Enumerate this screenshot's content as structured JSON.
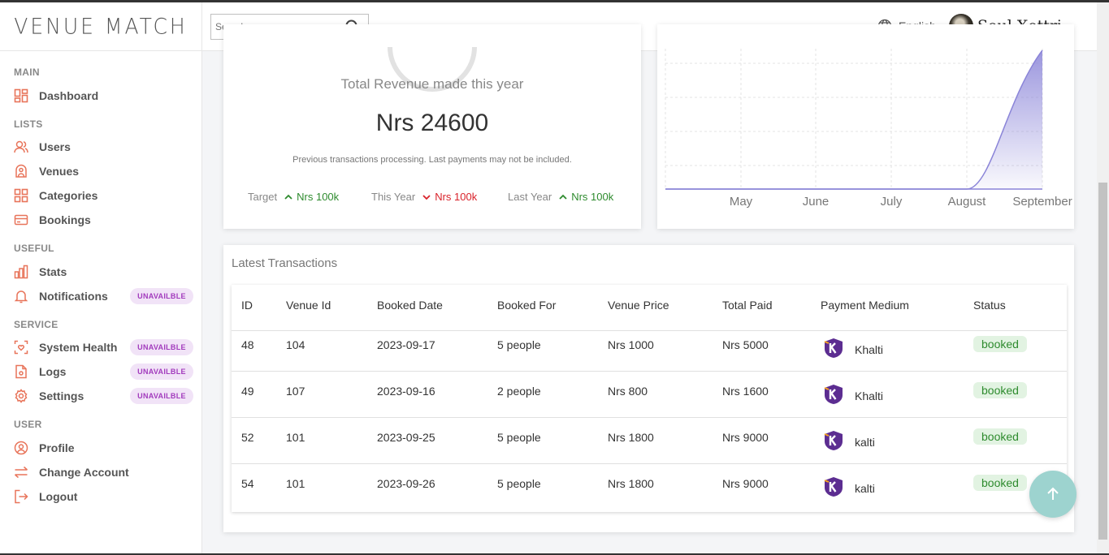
{
  "app": {
    "logo": "VENUE MATCH"
  },
  "header": {
    "search_placeholder": "Search...",
    "language": "English",
    "user_name": "Soul Xettri"
  },
  "sidebar": {
    "sections": {
      "main": "MAIN",
      "lists": "LISTS",
      "useful": "USEFUL",
      "service": "SERVICE",
      "user": "USER"
    },
    "items": {
      "dashboard": "Dashboard",
      "users": "Users",
      "venues": "Venues",
      "categories": "Categories",
      "bookings": "Bookings",
      "stats": "Stats",
      "notifications": "Notifications",
      "system_health": "System Health",
      "logs": "Logs",
      "settings": "Settings",
      "profile": "Profile",
      "change_account": "Change Account",
      "logout": "Logout"
    },
    "badge_unavailable": "UNAVAILBLE"
  },
  "revenue": {
    "title": "Total Revenue made this year",
    "amount": "Nrs 24600",
    "note": "Previous transactions processing. Last payments may not be included.",
    "stats": [
      {
        "key": "Target",
        "value": "Nrs 100k",
        "trend": "up"
      },
      {
        "key": "This Year",
        "value": "Nrs 100k",
        "trend": "down"
      },
      {
        "key": "Last Year",
        "value": "Nrs 100k",
        "trend": "up"
      }
    ]
  },
  "chart_data": {
    "type": "area",
    "categories": [
      "May",
      "June",
      "July",
      "August",
      "September"
    ],
    "series": [
      {
        "values": [
          0,
          0,
          0,
          0,
          24600
        ]
      }
    ],
    "grid": true
  },
  "transactions": {
    "title": "Latest Transactions",
    "columns": [
      "ID",
      "Venue Id",
      "Booked Date",
      "Booked For",
      "Venue Price",
      "Total Paid",
      "Payment Medium",
      "Status"
    ],
    "rows": [
      {
        "id": "48",
        "venue_id": "104",
        "date": "2023-09-17",
        "booked_for": "5 people",
        "venue_price": "Nrs 1000",
        "total_paid": "Nrs 5000",
        "medium": "Khalti",
        "status": "booked"
      },
      {
        "id": "49",
        "venue_id": "107",
        "date": "2023-09-16",
        "booked_for": "2 people",
        "venue_price": "Nrs 800",
        "total_paid": "Nrs 1600",
        "medium": "Khalti",
        "status": "booked"
      },
      {
        "id": "52",
        "venue_id": "101",
        "date": "2023-09-25",
        "booked_for": "5 people",
        "venue_price": "Nrs 1800",
        "total_paid": "Nrs 9000",
        "medium": "kalti",
        "status": "booked"
      },
      {
        "id": "54",
        "venue_id": "101",
        "date": "2023-09-26",
        "booked_for": "5 people",
        "venue_price": "Nrs 1800",
        "total_paid": "Nrs 9000",
        "medium": "kalti",
        "status": "booked"
      }
    ]
  },
  "colors": {
    "sidebar_icon": "#e8745a",
    "accent_purple": "#8a84d8",
    "status_green": "#2e8b2e",
    "trend_red": "#d9222a",
    "fab": "#9dd3cf",
    "badge_purple": "#a23bbd"
  }
}
